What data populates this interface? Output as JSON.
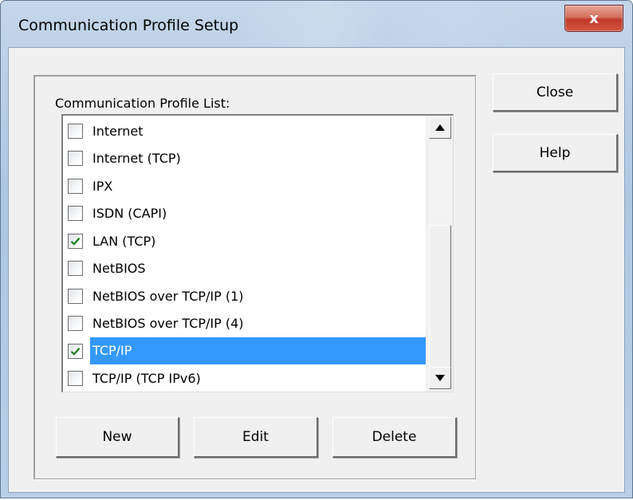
{
  "window": {
    "title": "Communication Profile Setup",
    "close_glyph": "x"
  },
  "profile_list": {
    "label": "Communication Profile List:",
    "items": [
      {
        "label": "Internet",
        "checked": false,
        "selected": false
      },
      {
        "label": "Internet (TCP)",
        "checked": false,
        "selected": false
      },
      {
        "label": "IPX",
        "checked": false,
        "selected": false
      },
      {
        "label": "ISDN (CAPI)",
        "checked": false,
        "selected": false
      },
      {
        "label": "LAN (TCP)",
        "checked": true,
        "selected": false
      },
      {
        "label": "NetBIOS",
        "checked": false,
        "selected": false
      },
      {
        "label": "NetBIOS over TCP/IP (1)",
        "checked": false,
        "selected": false
      },
      {
        "label": "NetBIOS over TCP/IP (4)",
        "checked": false,
        "selected": false
      },
      {
        "label": "TCP/IP",
        "checked": true,
        "selected": true
      },
      {
        "label": "TCP/IP (TCP IPv6)",
        "checked": false,
        "selected": false
      }
    ]
  },
  "buttons": {
    "new_label": "New",
    "edit_label": "Edit",
    "delete_label": "Delete",
    "close_label": "Close",
    "help_label": "Help"
  },
  "colors": {
    "selection": "#3399ff",
    "checkmark": "#1e7b1e",
    "dialog_face": "#f0f0f0"
  }
}
